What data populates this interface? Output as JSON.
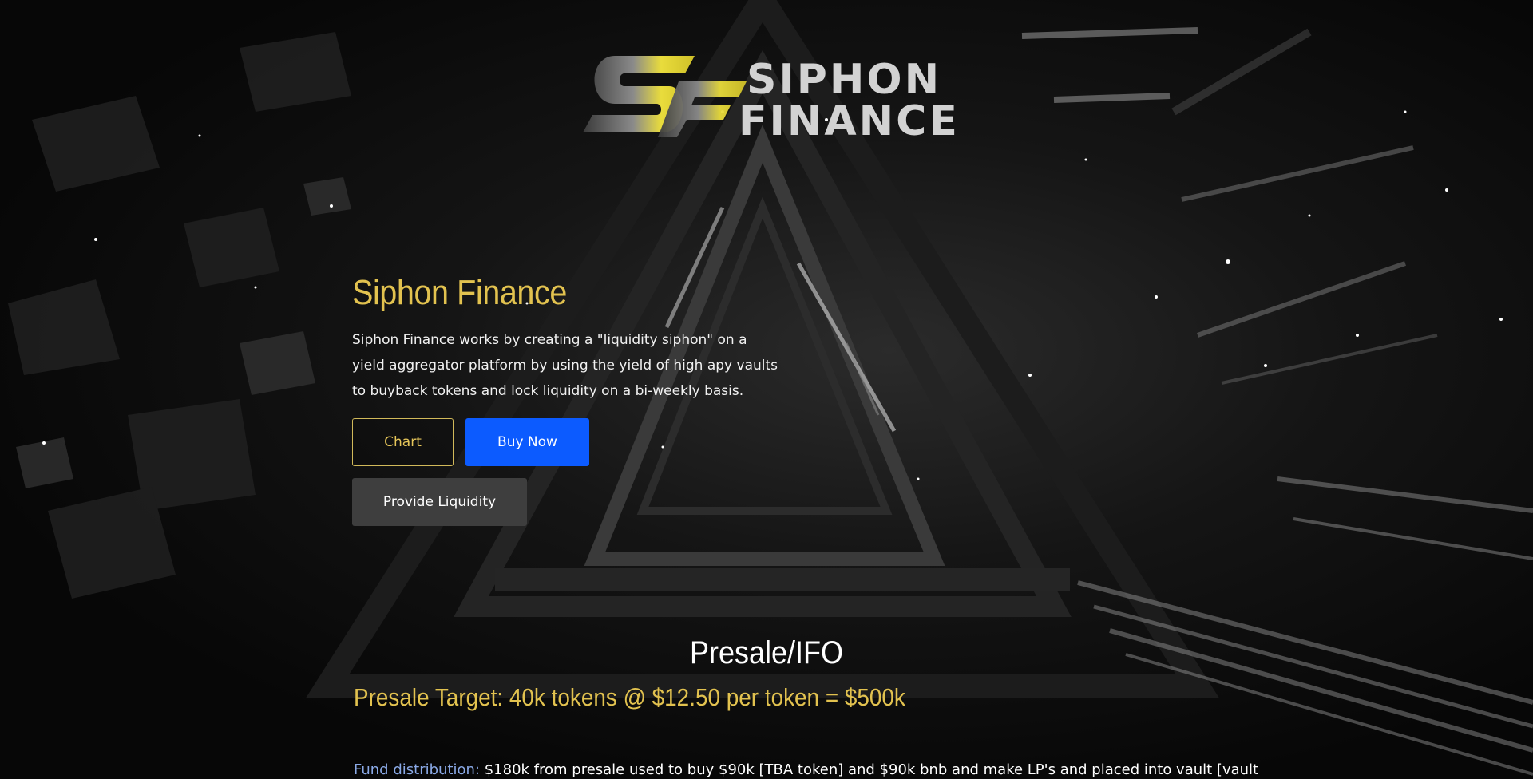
{
  "logo": {
    "mark": "SF",
    "line1": "SIPHON",
    "line2": "FINANCE"
  },
  "hero": {
    "title": "Siphon Finance",
    "description": "Siphon Finance works by creating a \"liquidity siphon\" on a yield aggregator platform by using the yield of high apy vaults to buyback tokens and lock liquidity on a bi-weekly basis.",
    "buttons": {
      "chart": "Chart",
      "buy": "Buy Now",
      "liquidity": "Provide Liquidity"
    }
  },
  "presale": {
    "title": "Presale/IFO",
    "target": "Presale Target: 40k tokens @ $12.50 per token = $500k",
    "fund_label": "Fund distribution:",
    "fund_text": " $180k from presale used to buy $90k [TBA token] and $90k bnb and make LP's and placed into vault [vault"
  },
  "colors": {
    "gold": "#e2c24f",
    "blue_button": "#0c5bff",
    "grey_button": "#3e3e3e",
    "link_blue": "#8aa9e6"
  }
}
